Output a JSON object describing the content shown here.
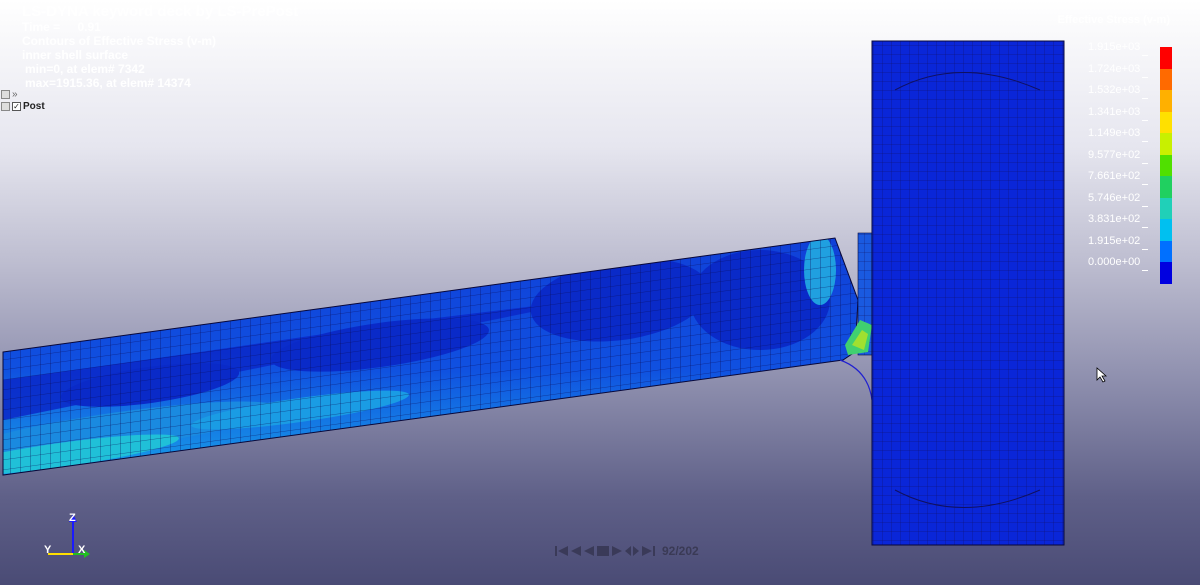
{
  "header": {
    "title": "LS-DYNA keyword deck by LS-PrePost",
    "time_label": "Time =",
    "time_value": "0.91",
    "contour_label": "Contours of Effective Stress (v-m)",
    "surface": "inner shell surface",
    "min_text": "min=0, at elem# 7342",
    "max_text": "max=1915.36, at elem# 14374"
  },
  "tree": {
    "arrows": "»",
    "post_label": "Post"
  },
  "legend": {
    "title": "Effective Stress (v-m)",
    "labels": [
      "1.915e+03",
      "1.724e+03",
      "1.532e+03",
      "1.341e+03",
      "1.149e+03",
      "9.577e+02",
      "7.661e+02",
      "5.746e+02",
      "3.831e+02",
      "1.915e+02",
      "0.000e+00"
    ],
    "colors": [
      "#ff0000",
      "#ff6a00",
      "#ffb000",
      "#ffe000",
      "#c8f000",
      "#50e000",
      "#20d060",
      "#20d0b8",
      "#00c0f0",
      "#0070ff",
      "#0000e0"
    ]
  },
  "axes": {
    "z_label": "Z",
    "y_label": "Y",
    "x_label": "X"
  },
  "player": {
    "frame_text": "92/202"
  }
}
